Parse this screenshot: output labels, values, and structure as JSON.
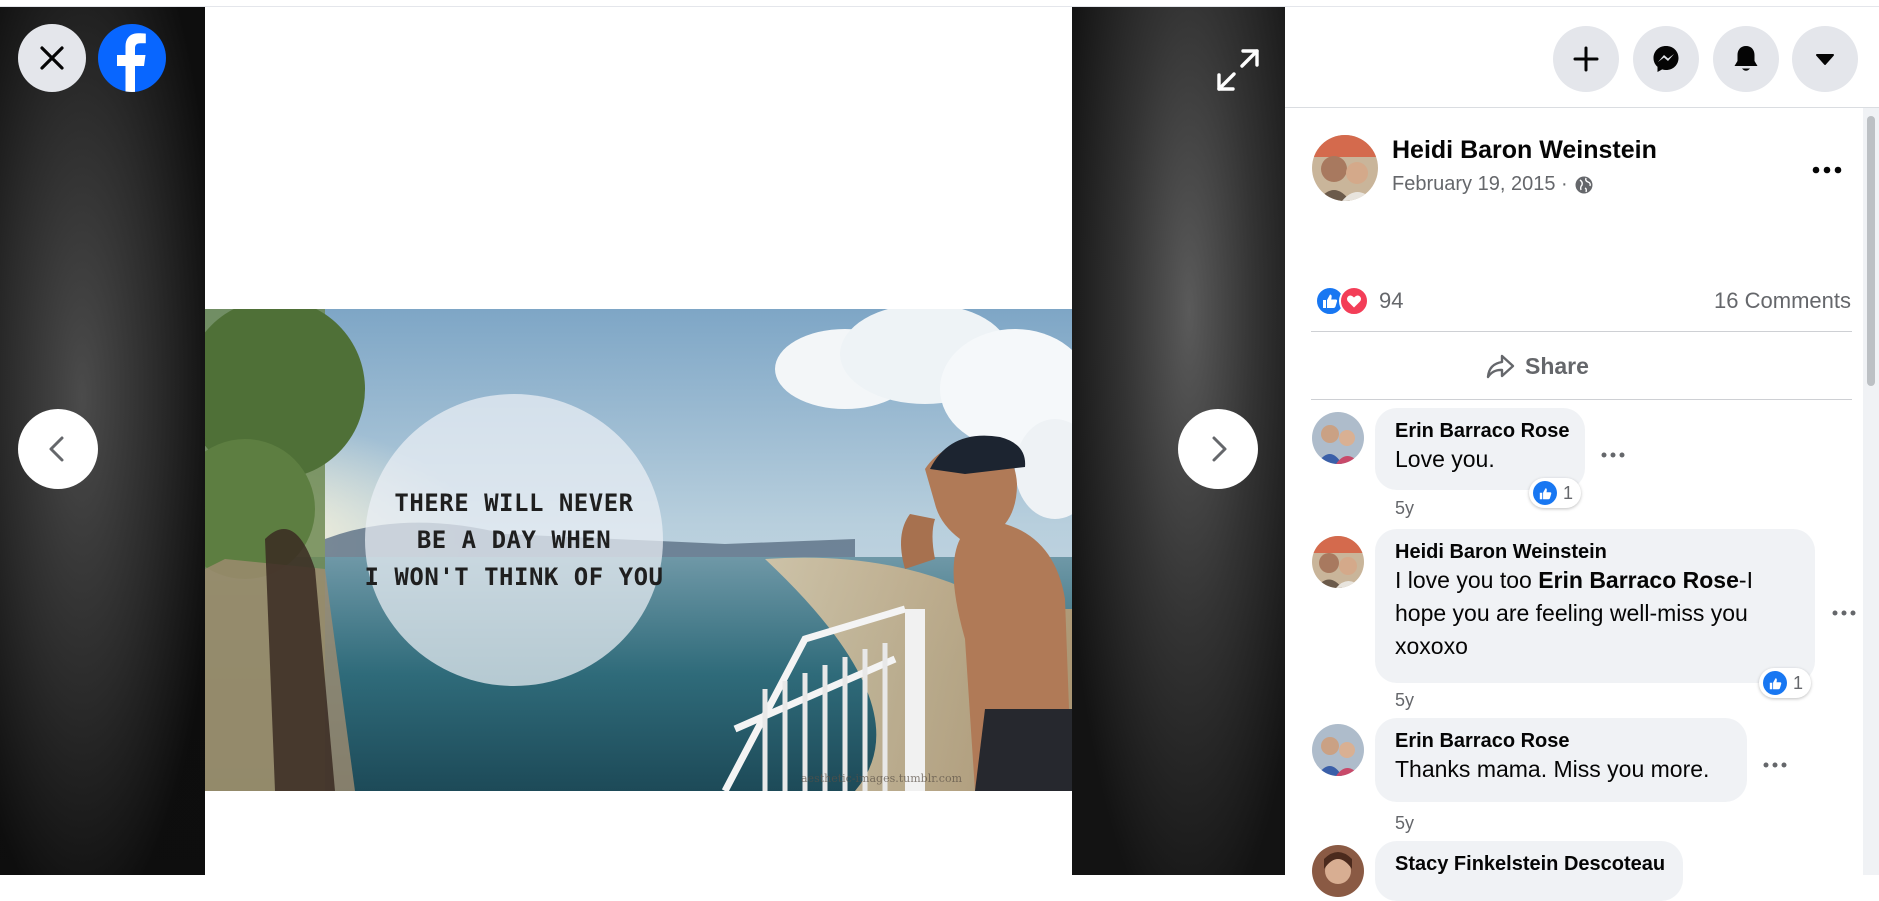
{
  "photo": {
    "quote_lines": [
      "THERE WILL NEVER",
      "BE A DAY WHEN",
      "I WON'T THINK OF YOU"
    ],
    "watermark": "aesthetic-images.tumblr.com"
  },
  "viewer_icons": {
    "close": "close-icon",
    "logo": "facebook-logo",
    "prev": "chevron-left-icon",
    "next": "chevron-right-icon",
    "expand": "expand-icon"
  },
  "topbar_icons": [
    "plus-icon",
    "messenger-icon",
    "bell-icon",
    "caret-down-icon"
  ],
  "post": {
    "author": "Heidi Baron Weinstein",
    "date": "February 19, 2015 ·",
    "audience_icon": "globe-icon",
    "reaction_count": "94",
    "comments_count": "16 Comments",
    "share_label": "Share"
  },
  "comments": [
    {
      "name": "Erin Barraco Rose",
      "text": "Love you.",
      "time": "5y",
      "likes": "1"
    },
    {
      "name": "Heidi Baron Weinstein",
      "text_pre": "I love you too ",
      "mention": "Erin Barraco Rose",
      "text_post": "-I hope you are feeling well-miss you xoxoxo",
      "time": "5y",
      "likes": "1"
    },
    {
      "name": "Erin Barraco Rose",
      "text": "Thanks mama. Miss you more.",
      "time": "5y"
    },
    {
      "name": "Stacy Finkelstein Descoteau"
    }
  ],
  "colors": {
    "facebook_blue": "#0866ff",
    "like_blue": "#1877f2",
    "love_red": "#f33e58",
    "bubble_gray": "#f0f2f5",
    "secondary_text": "#65676b"
  }
}
